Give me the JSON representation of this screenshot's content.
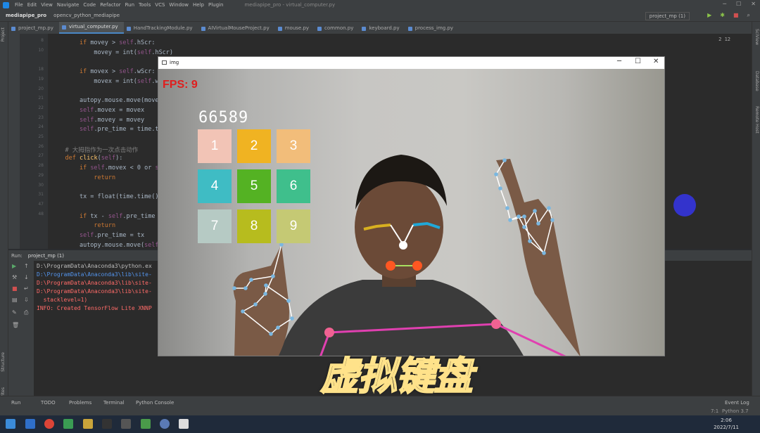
{
  "menubar": {
    "items": [
      "File",
      "Edit",
      "View",
      "Navigate",
      "Code",
      "Refactor",
      "Run",
      "Tools",
      "VCS",
      "Window",
      "Help",
      "Plugin"
    ],
    "window_title": "mediapipe_pro - virtual_computer.py"
  },
  "navbar": {
    "project": "mediapipe_pro",
    "folder": "opencv_python_mediapipe",
    "run_config": "project_mp (1)"
  },
  "editor_tabs": [
    "project_mp.py",
    "virtual_computer.py",
    "HandTrackingModule.py",
    "AIVirtualMouseProject.py",
    "mouse.py",
    "common.py",
    "keyboard.py",
    "process_img.py"
  ],
  "editor": {
    "inspections": "2  12",
    "line_numbers": [
      "8",
      "10",
      "",
      "18",
      "19",
      "20",
      "21",
      "22",
      "23",
      "24",
      "25",
      "26",
      "27",
      "28",
      "29",
      "30",
      "31",
      "47",
      "48"
    ],
    "lines": [
      {
        "indent": "        ",
        "parts": [
          {
            "t": "if ",
            "c": "kw"
          },
          {
            "t": "movey > ",
            "c": ""
          },
          {
            "t": "self",
            "c": "self"
          },
          {
            "t": ".hScr:",
            "c": ""
          }
        ]
      },
      {
        "indent": "            ",
        "parts": [
          {
            "t": "movey = int(",
            "c": ""
          },
          {
            "t": "self",
            "c": "self"
          },
          {
            "t": ".hScr)",
            "c": ""
          }
        ]
      },
      {
        "indent": "",
        "parts": []
      },
      {
        "indent": "        ",
        "parts": [
          {
            "t": "if ",
            "c": "kw"
          },
          {
            "t": "movex > ",
            "c": ""
          },
          {
            "t": "self",
            "c": "self"
          },
          {
            "t": ".wScr:",
            "c": ""
          }
        ]
      },
      {
        "indent": "            ",
        "parts": [
          {
            "t": "movex = int(",
            "c": ""
          },
          {
            "t": "self",
            "c": "self"
          },
          {
            "t": ".wS",
            "c": ""
          }
        ]
      },
      {
        "indent": "",
        "parts": []
      },
      {
        "indent": "        ",
        "parts": [
          {
            "t": "autopy.mouse.move(movex",
            "c": ""
          }
        ]
      },
      {
        "indent": "        ",
        "parts": [
          {
            "t": "self",
            "c": "self"
          },
          {
            "t": ".movex = movex",
            "c": ""
          }
        ]
      },
      {
        "indent": "        ",
        "parts": [
          {
            "t": "self",
            "c": "self"
          },
          {
            "t": ".movey = movey",
            "c": ""
          }
        ]
      },
      {
        "indent": "        ",
        "parts": [
          {
            "t": "self",
            "c": "self"
          },
          {
            "t": ".pre_time = time.ti",
            "c": ""
          }
        ]
      },
      {
        "indent": "",
        "parts": []
      },
      {
        "indent": "    ",
        "parts": [
          {
            "t": "# 大拇指作为一次点击动作",
            "c": "cm"
          }
        ]
      },
      {
        "indent": "    ",
        "parts": [
          {
            "t": "def ",
            "c": "kw"
          },
          {
            "t": "click",
            "c": "fn"
          },
          {
            "t": "(",
            "c": ""
          },
          {
            "t": "self",
            "c": "self"
          },
          {
            "t": "):",
            "c": ""
          }
        ]
      },
      {
        "indent": "        ",
        "parts": [
          {
            "t": "if ",
            "c": "kw"
          },
          {
            "t": "self",
            "c": "self"
          },
          {
            "t": ".movex < 0 or ",
            "c": ""
          },
          {
            "t": "se",
            "c": "self"
          }
        ]
      },
      {
        "indent": "            ",
        "parts": [
          {
            "t": "return",
            "c": "kw"
          }
        ]
      },
      {
        "indent": "",
        "parts": []
      },
      {
        "indent": "        ",
        "parts": [
          {
            "t": "tx = float(time.time())",
            "c": ""
          }
        ]
      },
      {
        "indent": "",
        "parts": []
      },
      {
        "indent": "        ",
        "parts": [
          {
            "t": "if ",
            "c": "kw"
          },
          {
            "t": "tx - ",
            "c": ""
          },
          {
            "t": "self",
            "c": "self"
          },
          {
            "t": ".pre_time <",
            "c": ""
          }
        ]
      },
      {
        "indent": "            ",
        "parts": [
          {
            "t": "return",
            "c": "kw"
          }
        ]
      },
      {
        "indent": "        ",
        "parts": [
          {
            "t": "self",
            "c": "self"
          },
          {
            "t": ".pre_time = tx",
            "c": ""
          }
        ]
      },
      {
        "indent": "        ",
        "parts": [
          {
            "t": "autopy.mouse.move(",
            "c": ""
          },
          {
            "t": "self",
            "c": "self"
          },
          {
            "t": ".",
            "c": ""
          }
        ]
      }
    ]
  },
  "run_panel": {
    "label": "Run:",
    "tab": "project_mp (1)",
    "console": [
      {
        "text": "D:\\ProgramData\\Anaconda3\\python.ex",
        "color": "#bbbbbb"
      },
      {
        "text": "D:\\ProgramData\\Anaconda3\\lib\\site-",
        "color": "#5394ec"
      },
      {
        "text": "D:\\ProgramData\\Anaconda3\\lib\\site-",
        "color": "#ff6b68"
      },
      {
        "text": "D:\\ProgramData\\Anaconda3\\lib\\site-",
        "color": "#ff6b68"
      },
      {
        "text": "  stacklevel=1)",
        "color": "#ff6b68"
      },
      {
        "text": "INFO: Created TensorFlow Lite XNNP",
        "color": "#ff6b68"
      }
    ]
  },
  "bottom_tabs": [
    "Run",
    "TODO",
    "Problems",
    "Terminal",
    "Python Console"
  ],
  "event_log": "Event Log",
  "status_bar": "Python 3.7",
  "status_pos": "7:1",
  "taskbar": {
    "time": "2:06",
    "date": "2022/7/11"
  },
  "img_window": {
    "title": "img",
    "fps": "FPS: 9",
    "typed": "66589",
    "keys": [
      {
        "label": "1",
        "color": "#f2c4b6"
      },
      {
        "label": "2",
        "color": "#f0b322"
      },
      {
        "label": "3",
        "color": "#f2bd7a"
      },
      {
        "label": "4",
        "color": "#3fbcc4"
      },
      {
        "label": "5",
        "color": "#54b223"
      },
      {
        "label": "6",
        "color": "#3fbf8c"
      },
      {
        "label": "7",
        "color": "#b6cac4"
      },
      {
        "label": "8",
        "color": "#b7bc1e"
      },
      {
        "label": "9",
        "color": "#c5c974"
      }
    ]
  },
  "subtitle": "虚拟键盘"
}
